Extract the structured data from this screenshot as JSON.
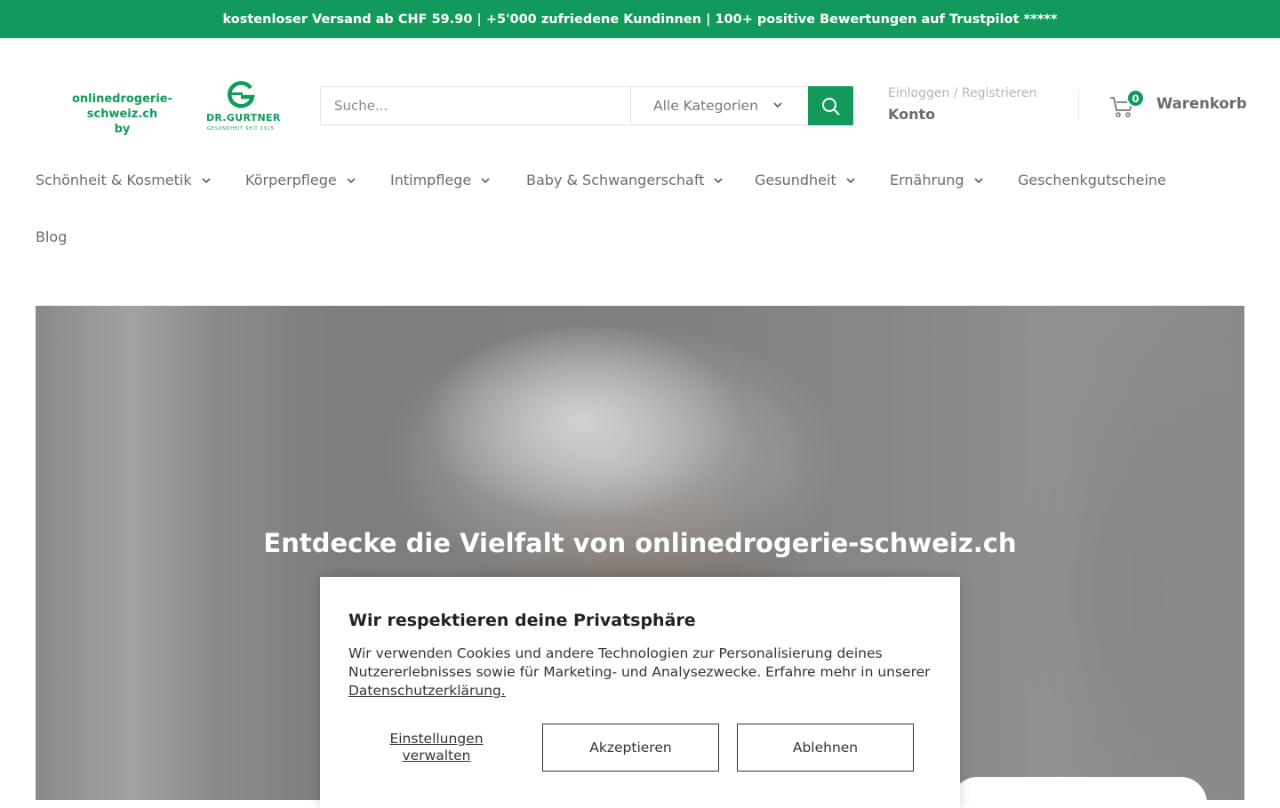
{
  "announcement": "kostenloser Versand ab CHF 59.90 | +5'000 zufriedene Kundinnen | 100+ positive Bewertungen auf Trustpilot *****",
  "colors": {
    "brand": "#119a5b",
    "text": "#6b6b6b",
    "muted": "#b5b5b5"
  },
  "logo": {
    "site_line1": "onlinedrogerie-schweiz.ch",
    "site_line2": "by",
    "brand_name": "DR.GURTNER",
    "brand_tag": "GESUNDHEIT SEIT 1915"
  },
  "search": {
    "placeholder": "Suche...",
    "category": "Alle Kategorien",
    "button_icon": "search-icon"
  },
  "account": {
    "login": "Einloggen / Registrieren",
    "label": "Konto"
  },
  "cart": {
    "count": "0",
    "label": "Warenkorb",
    "icon": "cart-icon"
  },
  "nav": {
    "items": [
      {
        "label": "Schönheit & Kosmetik",
        "dropdown": true
      },
      {
        "label": "Körperpflege",
        "dropdown": true
      },
      {
        "label": "Intimpflege",
        "dropdown": true
      },
      {
        "label": "Baby & Schwangerschaft",
        "dropdown": true
      },
      {
        "label": "Gesundheit",
        "dropdown": true
      },
      {
        "label": "Ernährung",
        "dropdown": true
      },
      {
        "label": "Geschenkgutscheine",
        "dropdown": false
      },
      {
        "label": "Blog",
        "dropdown": false
      }
    ]
  },
  "hero": {
    "headline": "Entdecke die Vielfalt von onlinedrogerie-schweiz.ch"
  },
  "cookie": {
    "title": "Wir respektieren deine Privatsphäre",
    "text": "Wir verwenden Cookies und andere Technologien zur Personalisierung deines Nutzererlebnisses sowie für Marketing- und Analysezwecke. Erfahre mehr in unserer",
    "link": "Datenschutzerklärung.",
    "manage": "Einstellungen verwalten",
    "accept": "Akzeptieren",
    "reject": "Ablehnen"
  }
}
